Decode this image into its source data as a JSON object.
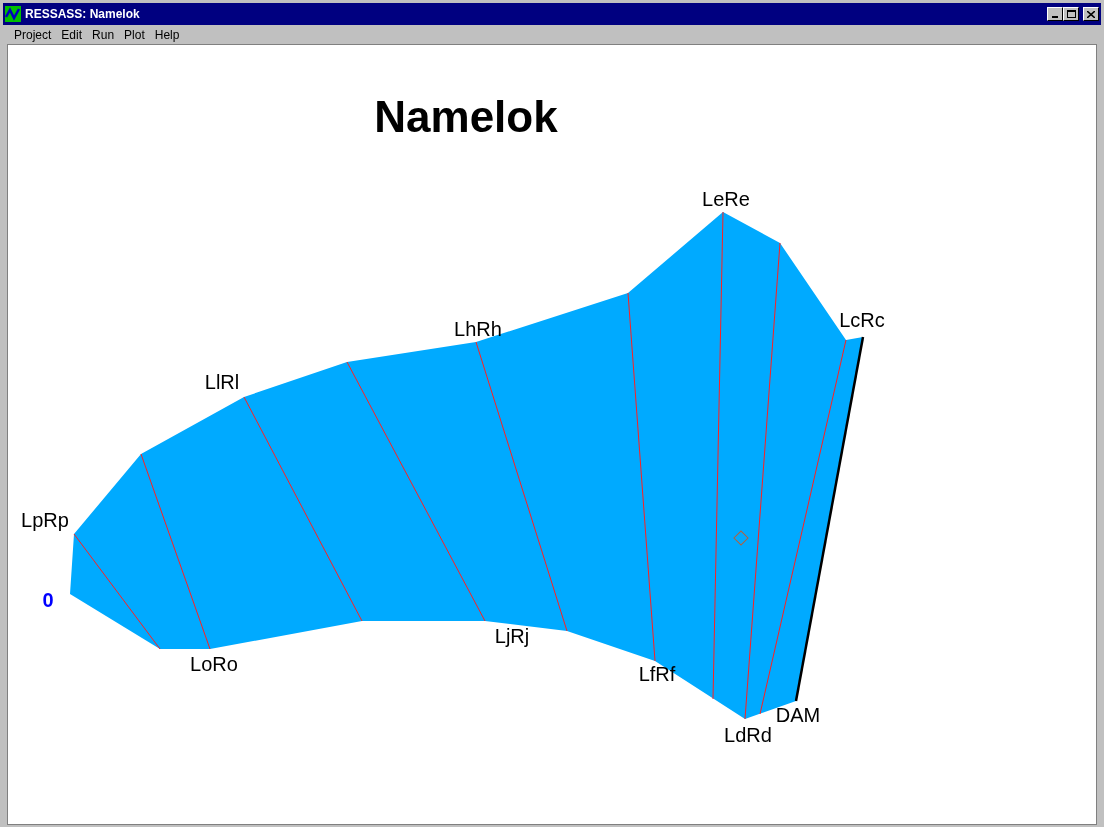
{
  "window": {
    "title": "RESSASS: Namelok"
  },
  "menu": [
    {
      "label": "Project"
    },
    {
      "label": "Edit"
    },
    {
      "label": "Run"
    },
    {
      "label": "Plot"
    },
    {
      "label": "Help"
    }
  ],
  "plot": {
    "title": "Namelok",
    "labels": [
      {
        "text": "LeRe",
        "kind": "node"
      },
      {
        "text": "LcRc",
        "kind": "node"
      },
      {
        "text": "LhRh",
        "kind": "node"
      },
      {
        "text": "LlRl",
        "kind": "node"
      },
      {
        "text": "LpRp",
        "kind": "node"
      },
      {
        "text": "0",
        "kind": "origin"
      },
      {
        "text": "LoRo",
        "kind": "node"
      },
      {
        "text": "LjRj",
        "kind": "node"
      },
      {
        "text": "LfRf",
        "kind": "node"
      },
      {
        "text": "LdRd",
        "kind": "node"
      },
      {
        "text": "DAM",
        "kind": "node"
      }
    ]
  }
}
